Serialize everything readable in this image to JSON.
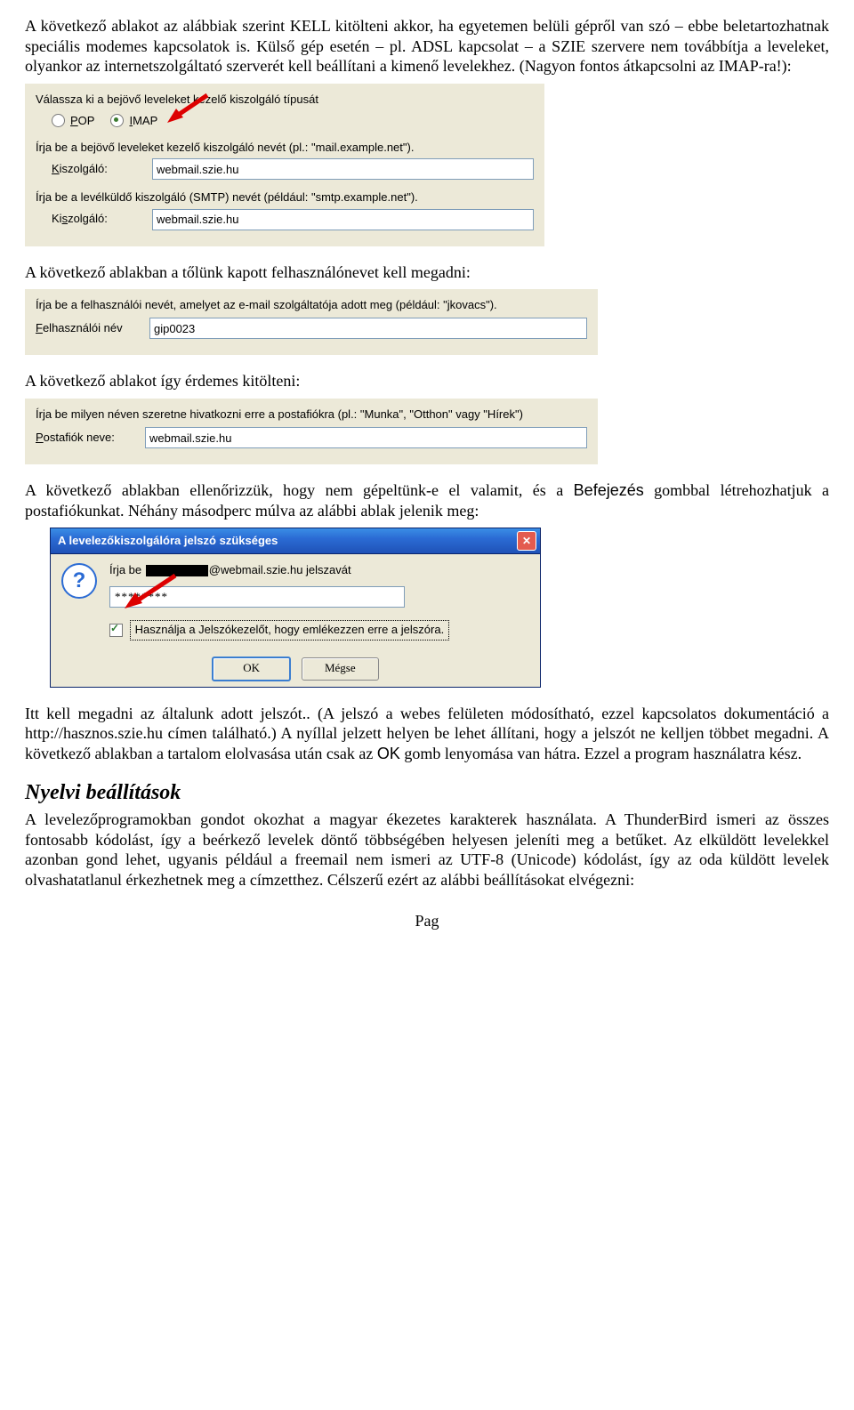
{
  "para1": "A következő ablakot az alábbiak szerint KELL kitölteni akkor, ha egyetemen belüli gépről van szó – ebbe beletartozhatnak speciális modemes kapcsolatok is. Külső gép esetén – pl. ADSL kapcsolat – a SZIE szervere nem továbbítja a leveleket, olyankor az internetszolgáltató szerverét kell beállítani a kimenő levelekhez. (Nagyon fontos átkapcsolni az IMAP-ra!):",
  "panel1": {
    "heading": "Válassza ki a bejövő leveleket kezelő kiszolgáló típusát",
    "pop_u": "P",
    "pop_rest": "OP",
    "imap_u": "I",
    "imap_rest": "MAP",
    "line_incoming": "Írja be a bejövő leveleket kezelő kiszolgáló nevét (pl.: \"mail.example.net\").",
    "label_server_u": "K",
    "label_server_rest": "iszolgáló:",
    "server_value": "webmail.szie.hu",
    "line_smtp": "Írja be a levélküldő kiszolgáló (SMTP) nevét (például: \"smtp.example.net\").",
    "label_server2_rest": "Ki",
    "label_server2_u": "s",
    "label_server2_tail": "zolgáló:",
    "server2_value": "webmail.szie.hu"
  },
  "para2": "A következő ablakban a tőlünk kapott felhasználónevet kell megadni:",
  "panel2": {
    "line1": "Írja be a felhasználói nevét, amelyet az e-mail szolgáltatója adott meg (például: \"jkovacs\").",
    "label_u": "F",
    "label_rest": "elhasználói név",
    "value": "gip0023"
  },
  "para3": "A következő ablakot így érdemes kitölteni:",
  "panel3": {
    "line1": "Írja be milyen néven szeretne hivatkozni erre a postafiókra (pl.: \"Munka\", \"Otthon\" vagy \"Hírek\")",
    "label_u": "P",
    "label_rest": "ostafiók neve:",
    "value": "webmail.szie.hu"
  },
  "para4a": "A következő ablakban ellenőrizzük, hogy nem gépeltünk-e el valamit, és a ",
  "befejes": "Befejezés",
  "para4b": " gombbal létrehozhatjuk a postafiókunkat. Néhány másodperc múlva az alábbi ablak jelenik meg:",
  "dialog": {
    "title": "A levelezőkiszolgálóra jelszó szükséges",
    "prompt_pre": "Írja be ",
    "prompt_post": "@webmail.szie.hu jelszavát",
    "pw_value": "********",
    "checkbox_label": "Használja a Jelszókezelőt, hogy emlékezzen erre a jelszóra.",
    "ok": "OK",
    "cancel": "Mégse"
  },
  "para5": "Itt kell megadni az általunk adott jelszót.. (A jelszó a webes felületen módosítható, ezzel kapcsolatos dokumentáció a http://hasznos.szie.hu címen található.) A nyíllal jelzett helyen be lehet állítani, hogy a jelszót ne kelljen többet megadni. A következő ablakban a tartalom elolvasása után csak az ",
  "ok_word": "OK",
  "para5b": " gomb lenyomása van hátra. Ezzel a program használatra kész.",
  "heading2": "Nyelvi beállítások",
  "para6": "A levelezőprogramokban gondot okozhat a magyar ékezetes karakterek használata. A ThunderBird ismeri az összes fontosabb kódolást, így a beérkező levelek döntő többségében helyesen jeleníti meg a betűket. Az elküldött levelekkel azonban gond lehet, ugyanis például a freemail nem ismeri az UTF-8 (Unicode) kódolást, így az oda küldött levelek olvashatatlanul érkezhetnek meg a címzetthez. Célszerű ezért az alábbi beállításokat elvégezni:",
  "pag": "Pag"
}
